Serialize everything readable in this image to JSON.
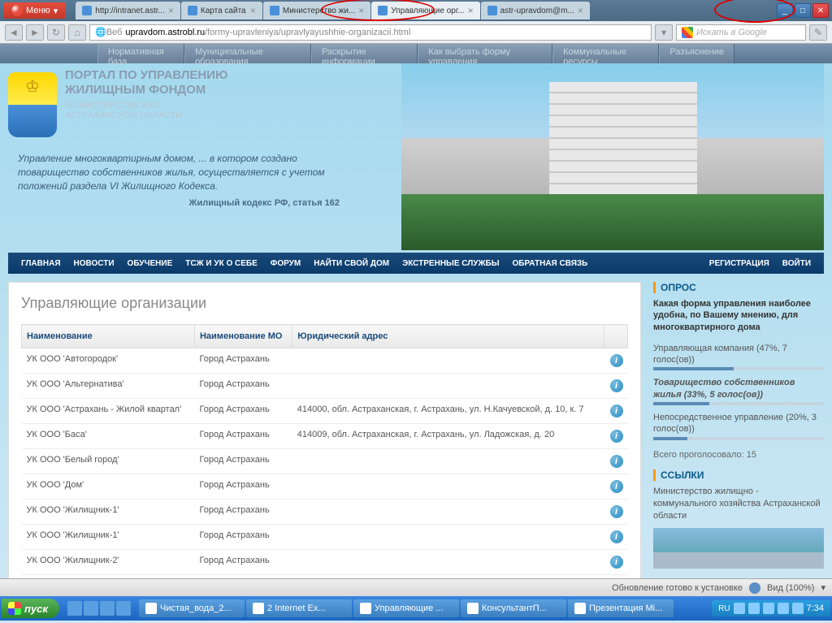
{
  "browser": {
    "menu": "Меню",
    "tabs": [
      {
        "label": "http://intranet.astr..."
      },
      {
        "label": "Карта сайта"
      },
      {
        "label": "Министерство жи..."
      },
      {
        "label": "Управляющие орг...",
        "active": true
      },
      {
        "label": "astr-upravdom@m..."
      }
    ],
    "url_prefix": "Веб",
    "url_host": "upravdom.astrobl.ru",
    "url_path": "/formy-upravleniya/upravlyayushhie-organizacii.html",
    "search_placeholder": "Искать в Google"
  },
  "top_nav": [
    "Нормативная база",
    "Муниципальные образования",
    "Раскрытие информации",
    "Как выбрать форму управления",
    "Коммунальные ресурсы",
    "Разъяснение"
  ],
  "portal": {
    "title1": "ПОРТАЛ ПО УПРАВЛЕНИЮ",
    "title2": "ЖИЛИЩНЫМ ФОНДОМ",
    "sub1": "МИНИСТЕРСТВА ЖКХ",
    "sub2": "АСТРАХАНСКОЙ ОБЛАСТИ",
    "quote": "Управление многоквартирным домом, ... в котором создано товарищество собственников жилья, осуществляется с учетом положений раздела VI Жилищного Кодекса.",
    "cite": "Жилищный кодекс РФ, статья 162"
  },
  "main_nav": {
    "left": [
      "ГЛАВНАЯ",
      "НОВОСТИ",
      "ОБУЧЕНИЕ",
      "ТСЖ И УК О СЕБЕ",
      "ФОРУМ",
      "НАЙТИ СВОЙ ДОМ",
      "ЭКСТРЕННЫЕ СЛУЖБЫ",
      "ОБРАТНАЯ СВЯЗЬ"
    ],
    "right": [
      "РЕГИСТРАЦИЯ",
      "ВОЙТИ"
    ]
  },
  "page_title": "Управляющие организации",
  "table": {
    "headers": [
      "Наименование",
      "Наименование МО",
      "Юридический адрес",
      ""
    ],
    "rows": [
      [
        "УК ООО 'Автогородок'",
        "Город Астрахань",
        ""
      ],
      [
        "УК ООО 'Альтернатива'",
        "Город Астрахань",
        ""
      ],
      [
        "УК ООО 'Астрахань - Жилой квартал'",
        "Город Астрахань",
        "414000, обл. Астраханская, г. Астрахань, ул. Н.Качуевской, д. 10, к. 7"
      ],
      [
        "УК ООО 'Баса'",
        "Город Астрахань",
        "414009, обл. Астраханская, г. Астрахань, ул. Ладожская, д. 20"
      ],
      [
        "УК ООО 'Белый город'",
        "Город Астрахань",
        ""
      ],
      [
        "УК ООО 'Дом'",
        "Город Астрахань",
        ""
      ],
      [
        "УК ООО 'Жилищник-1'",
        "Город Астрахань",
        ""
      ],
      [
        "УК ООО 'Жилищник-1'",
        "Город Астрахань",
        ""
      ],
      [
        "УК ООО 'Жилищник-2'",
        "Город Астрахань",
        ""
      ]
    ]
  },
  "sidebar": {
    "poll_header": "ОПРОС",
    "poll_q": "Какая форма управления наиболее удобна, по Вашему мнению, для многоквартирного дома",
    "opts": [
      {
        "label": "Управляющая компания (47%, 7 голос(ов))",
        "pct": 47,
        "sel": false
      },
      {
        "label": "Товарищество собственников жилья (33%, 5 голос(ов))",
        "pct": 33,
        "sel": true
      },
      {
        "label": "Непосредственное управление (20%, 3 голос(ов))",
        "pct": 20,
        "sel": false
      }
    ],
    "total": "Всего проголосовало: 15",
    "links_header": "ССЫЛКИ",
    "link1": "Министерство жилищно - коммунального хозяйства Астраханской области"
  },
  "status": {
    "update": "Обновление готово к установке",
    "zoom": "Вид (100%)"
  },
  "taskbar": {
    "start": "пуск",
    "items": [
      "Чистая_вода_2...",
      "2 Internet Ex...",
      "Управляющие ...",
      "КонсультантП...",
      "Презентация Mi..."
    ],
    "lang": "RU",
    "time": "7:34"
  }
}
